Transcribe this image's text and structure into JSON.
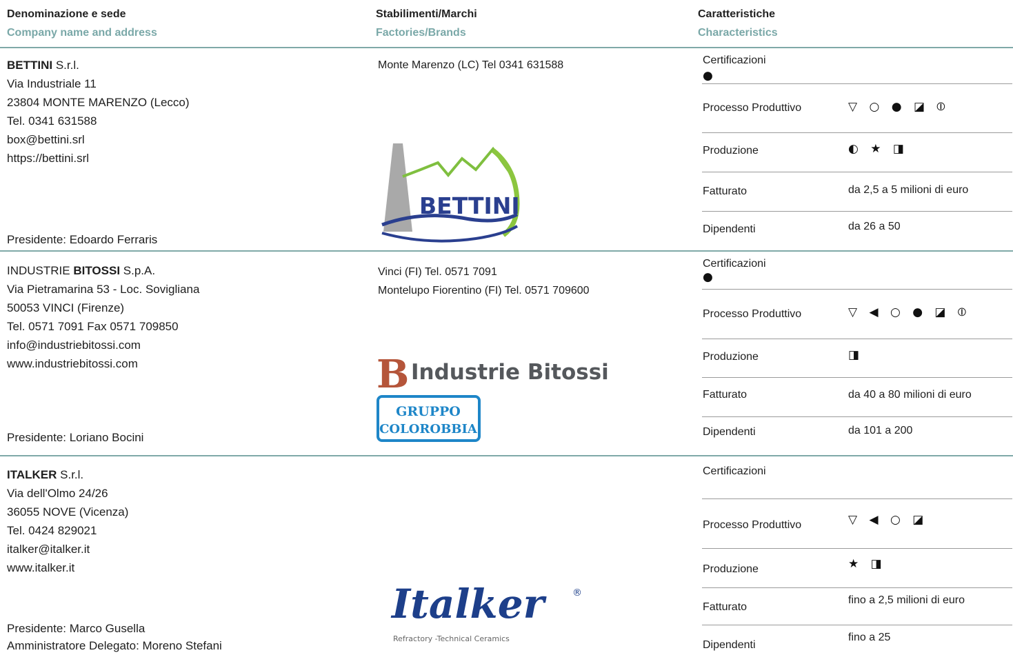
{
  "headers": {
    "col1_it": "Denominazione e sede",
    "col1_en": "Company name and address",
    "col2_it": "Stabilimenti/Marchi",
    "col2_en": "Factories/Brands",
    "col3_it": "Caratteristiche",
    "col3_en": "Characteristics"
  },
  "labels": {
    "certificazioni": "Certificazioni",
    "processo": "Processo Produttivo",
    "produzione": "Produzione",
    "fatturato": "Fatturato",
    "dipendenti": "Dipendenti"
  },
  "companies": [
    {
      "name_bold": "BETTINI",
      "name_rest": " S.r.l.",
      "address": [
        "Via Industriale 11",
        "23804 MONTE MARENZO (Lecco)",
        "Tel. 0341 631588",
        "box@bettini.srl",
        "https://bettini.srl"
      ],
      "officers": [
        "Presidente: Edoardo Ferraris"
      ],
      "plants": [
        "Monte Marenzo (LC) Tel 0341 631588"
      ],
      "logo_text": "BETTINI",
      "certificazioni": "●",
      "processo": "▽ ○ ● ◪ ⦶",
      "produzione": "◐ ★ ◨",
      "fatturato": "da 2,5 a 5 milioni di euro",
      "dipendenti": "da 26 a 50"
    },
    {
      "name_pre": "INDUSTRIE ",
      "name_bold": "BITOSSI",
      "name_rest": " S.p.A.",
      "address": [
        "Via Pietramarina 53 - Loc. Sovigliana",
        "50053 VINCI (Firenze)",
        "Tel. 0571 7091  Fax 0571 709850",
        "info@industriebitossi.com",
        "www.industriebitossi.com"
      ],
      "officers": [
        "Presidente: Loriano Bocini"
      ],
      "plants": [
        "Vinci (FI)  Tel. 0571 7091",
        "Montelupo Fiorentino (FI)  Tel. 0571 709600"
      ],
      "logo_text": "Industrie  Bitossi",
      "logo_sub1": "GRUPPO",
      "logo_sub2": "COLOROBBIA",
      "certificazioni": "●",
      "processo": "▽ ◀ ○ ● ◪ ⦶",
      "produzione": "◨",
      "fatturato": "da 40 a 80 milioni di euro",
      "dipendenti": "da 101 a 200"
    },
    {
      "name_bold": "ITALKER",
      "name_rest": " S.r.l.",
      "address": [
        "Via dell'Olmo 24/26",
        "36055  NOVE  (Vicenza)",
        "Tel. 0424 829021",
        "italker@italker.it",
        "www.italker.it"
      ],
      "officers": [
        "Presidente: Marco Gusella",
        "Amministratore Delegato: Moreno Stefani"
      ],
      "logo_text": "Italker",
      "logo_sub": "Refractory -Technical Ceramics",
      "certificazioni": "",
      "processo": "▽ ◀ ○ ◪",
      "produzione": "★ ◨",
      "fatturato": "fino a 2,5  milioni di euro",
      "dipendenti": "fino a 25"
    }
  ]
}
